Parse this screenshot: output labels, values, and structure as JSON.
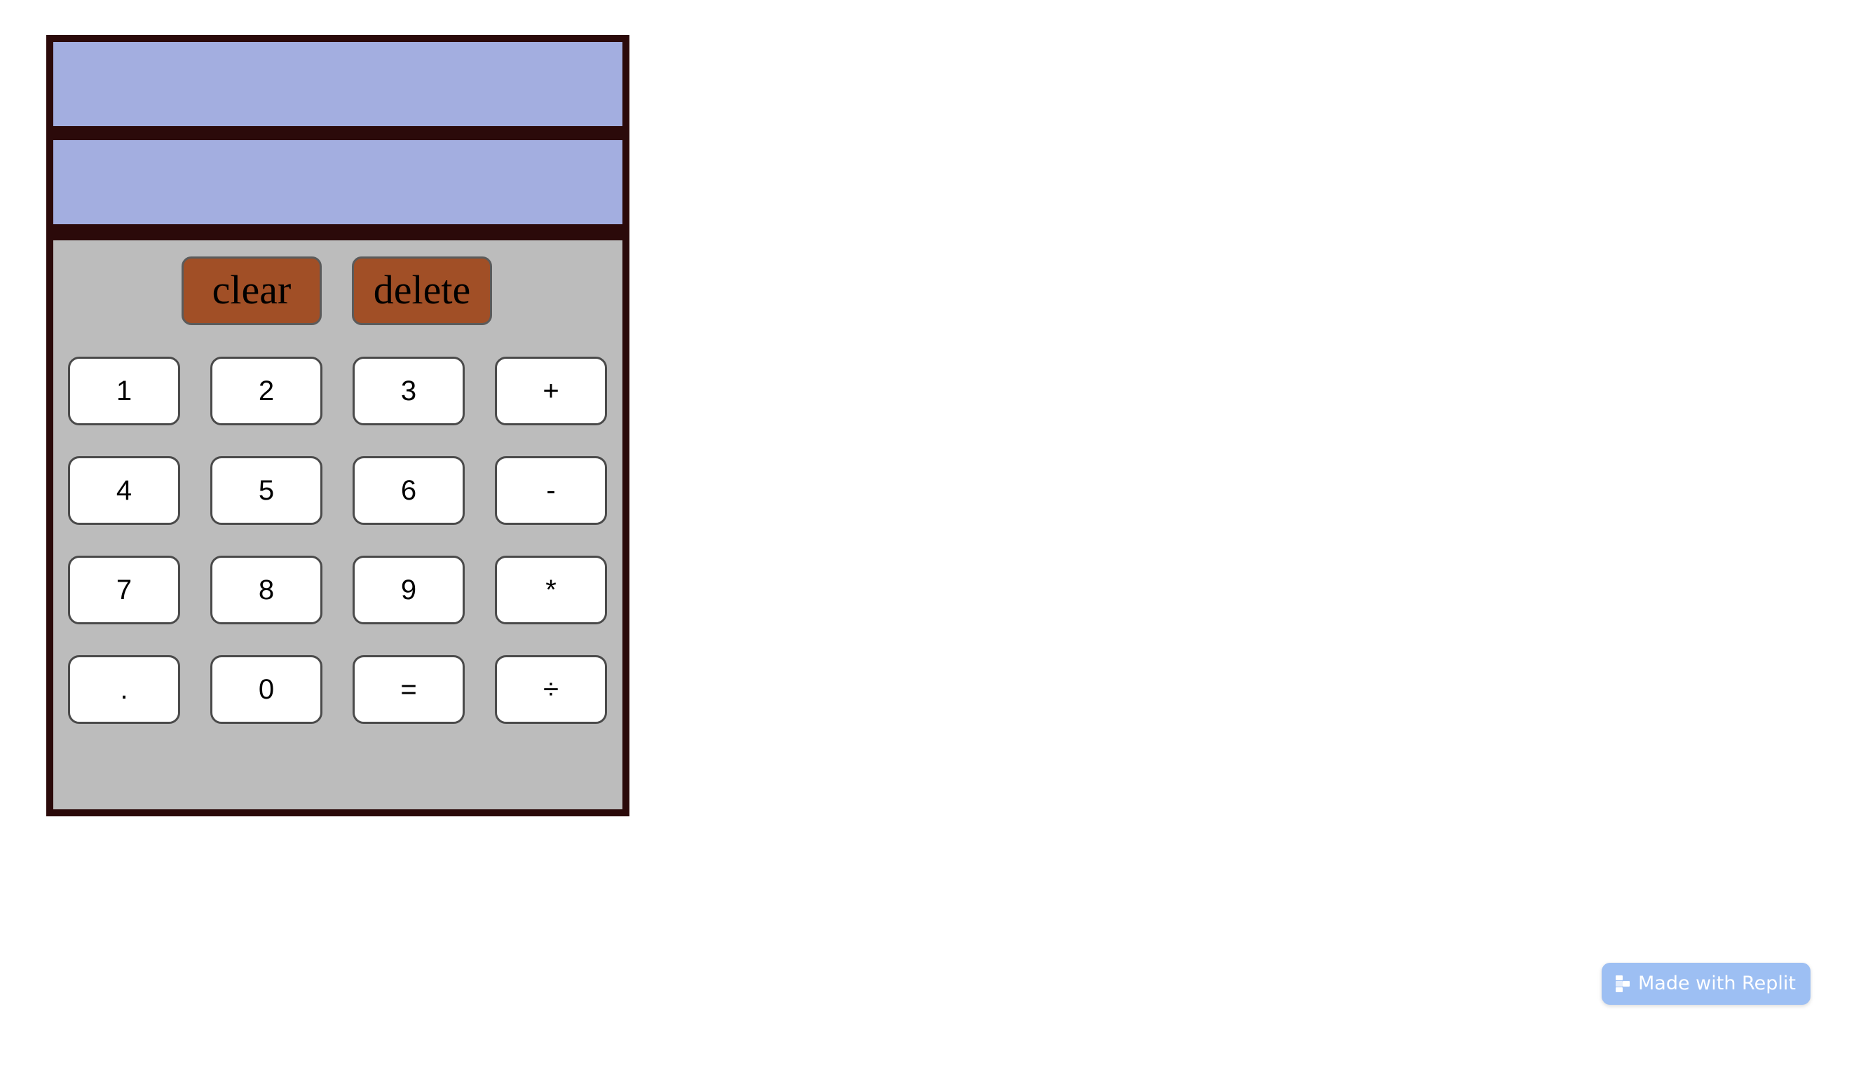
{
  "display": {
    "previous_operand": "",
    "current_operand": ""
  },
  "actions": {
    "clear_label": "clear",
    "delete_label": "delete"
  },
  "keys": [
    [
      "1",
      "2",
      "3",
      "+"
    ],
    [
      "4",
      "5",
      "6",
      "-"
    ],
    [
      "7",
      "8",
      "9",
      "*"
    ],
    [
      ".",
      "0",
      "=",
      "÷"
    ]
  ],
  "badge": {
    "label": "Made with Replit",
    "icon": "replit-logo-icon"
  },
  "colors": {
    "frame": "#2b0a0a",
    "screen": "#a3aee0",
    "keypad": "#bcbcbc",
    "action_button": "#a14f26",
    "key": "#ffffff",
    "badge": "#9dbff3"
  }
}
